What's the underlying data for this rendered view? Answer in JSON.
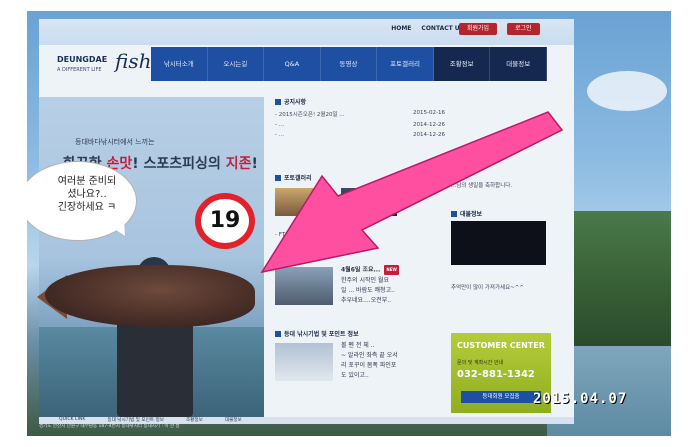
{
  "site": {
    "top_links": [
      "HOME",
      "CONTACT US"
    ],
    "join_label": "회원가입",
    "login_label": "로그인",
    "logo_text": "DEUNGDAE",
    "logo_fish": "fish",
    "logo_sub": "A DIFFERENT LIFE"
  },
  "nav": {
    "items": [
      "낚시터소개",
      "오시는길",
      "Q&A",
      "동영상",
      "포토갤러리",
      "조황정보",
      "대물정보"
    ]
  },
  "hero": {
    "small": "등대바다낚시터에서 느끼는",
    "main_prefix": "화끈한 ",
    "main_accent1": "손맛",
    "main_middle": "! 스포츠피싱의 ",
    "main_accent2": "지존",
    "main_suffix": "!"
  },
  "bubble": {
    "text": "여러분 준비되\n셨나요?..\n긴장하세요 ㅋ"
  },
  "badge": "19",
  "notice": {
    "title": "공지사항",
    "rows": [
      {
        "text": "- 2015시즌오픈! 2월20일 ...",
        "date": "2015-02-16"
      },
      {
        "text": "- ...",
        "date": "2014-12-26"
      },
      {
        "text": "- ...",
        "date": "2014-12-26"
      }
    ]
  },
  "gallery": {
    "title": "포토갤러리",
    "captions": [
      "- FT...",
      "...등대가족들.."
    ]
  },
  "video": {
    "title": "동영상",
    "line1": "4월6일 조요...",
    "new_badge": "NEW",
    "line2": "한주의 시작인 월요",
    "line3": "일 ... 바람도 쾌청고..",
    "line4": "추우네요....오전부.."
  },
  "spot": {
    "title": "등대 낚시기법 및 포인트 정보",
    "line1": "볼 펜 전 체 ..",
    "line2": "~ 알라인 좌측 끝 오서",
    "line3": "리 포꾸이 몸폭 파인포",
    "line4": "도 있이고.."
  },
  "right": {
    "price_title": "...회원",
    "price_text": "...님의 생일을 축하합니다.",
    "live_title": "대물정보",
    "live_text": "추억만이 많이 가져가세요~^^"
  },
  "customer_center": {
    "title": "CUSTOMER CENTER",
    "sub": "문의 및 계좌시간 안내",
    "phone": "032-881-1342",
    "button": "등대회원 모집중",
    "foot": "문의 및 계좌시간 안내 032 - 881 - 1342"
  },
  "quicklinks": {
    "items": [
      "QUICK LINK",
      "등대 낚시기법 및 포인트 정보",
      "조황정보",
      "대물정보"
    ]
  },
  "footer": {
    "text": "경기도 안산시 단원구 대부남동 187-4번지 등대낚시터 등대지기 : 이 한 흥"
  },
  "timestamp": "2015.04.07",
  "colors": {
    "nav": "#1e4fa2",
    "accent": "#c11f3b",
    "arrow": "#ff4fa0",
    "cc": "#a0bd2a"
  }
}
